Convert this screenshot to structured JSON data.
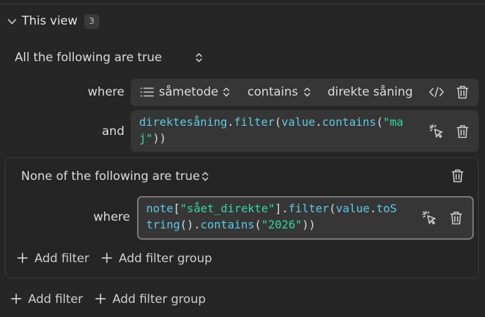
{
  "header": {
    "title": "This view",
    "count": "3"
  },
  "root_group": {
    "mode_label": "All the following are true",
    "filters": [
      {
        "keyword": "where",
        "property": "såmetode",
        "operator": "contains",
        "value": "direkte såning",
        "icons": [
          "list-icon",
          "code-icon",
          "trash-icon"
        ]
      },
      {
        "keyword": "and",
        "formula_line1": [
          "direktesåning",
          ".",
          "filter",
          "(",
          "value",
          ".",
          "contains",
          "(",
          "\"ma"
        ],
        "formula_line2": [
          "j\"",
          "))"
        ]
      }
    ]
  },
  "nested_group": {
    "mode_label": "None of the following are true",
    "filter": {
      "keyword": "where",
      "formula_line1": [
        "note",
        "[",
        "\"sået_direkte\"",
        "].",
        "filter",
        "(",
        "value",
        ".",
        "toS"
      ],
      "formula_line2": [
        "tring",
        "().",
        "contains",
        "(",
        "\"2026\"",
        "))"
      ]
    },
    "add_filter_label": "Add filter",
    "add_group_label": "Add filter group"
  },
  "footer": {
    "add_filter_label": "Add filter",
    "add_group_label": "Add filter group"
  },
  "colors": {
    "background": "#262626",
    "field": "#363636",
    "identifier": "#5fc9e6",
    "string": "#35d6a4"
  }
}
